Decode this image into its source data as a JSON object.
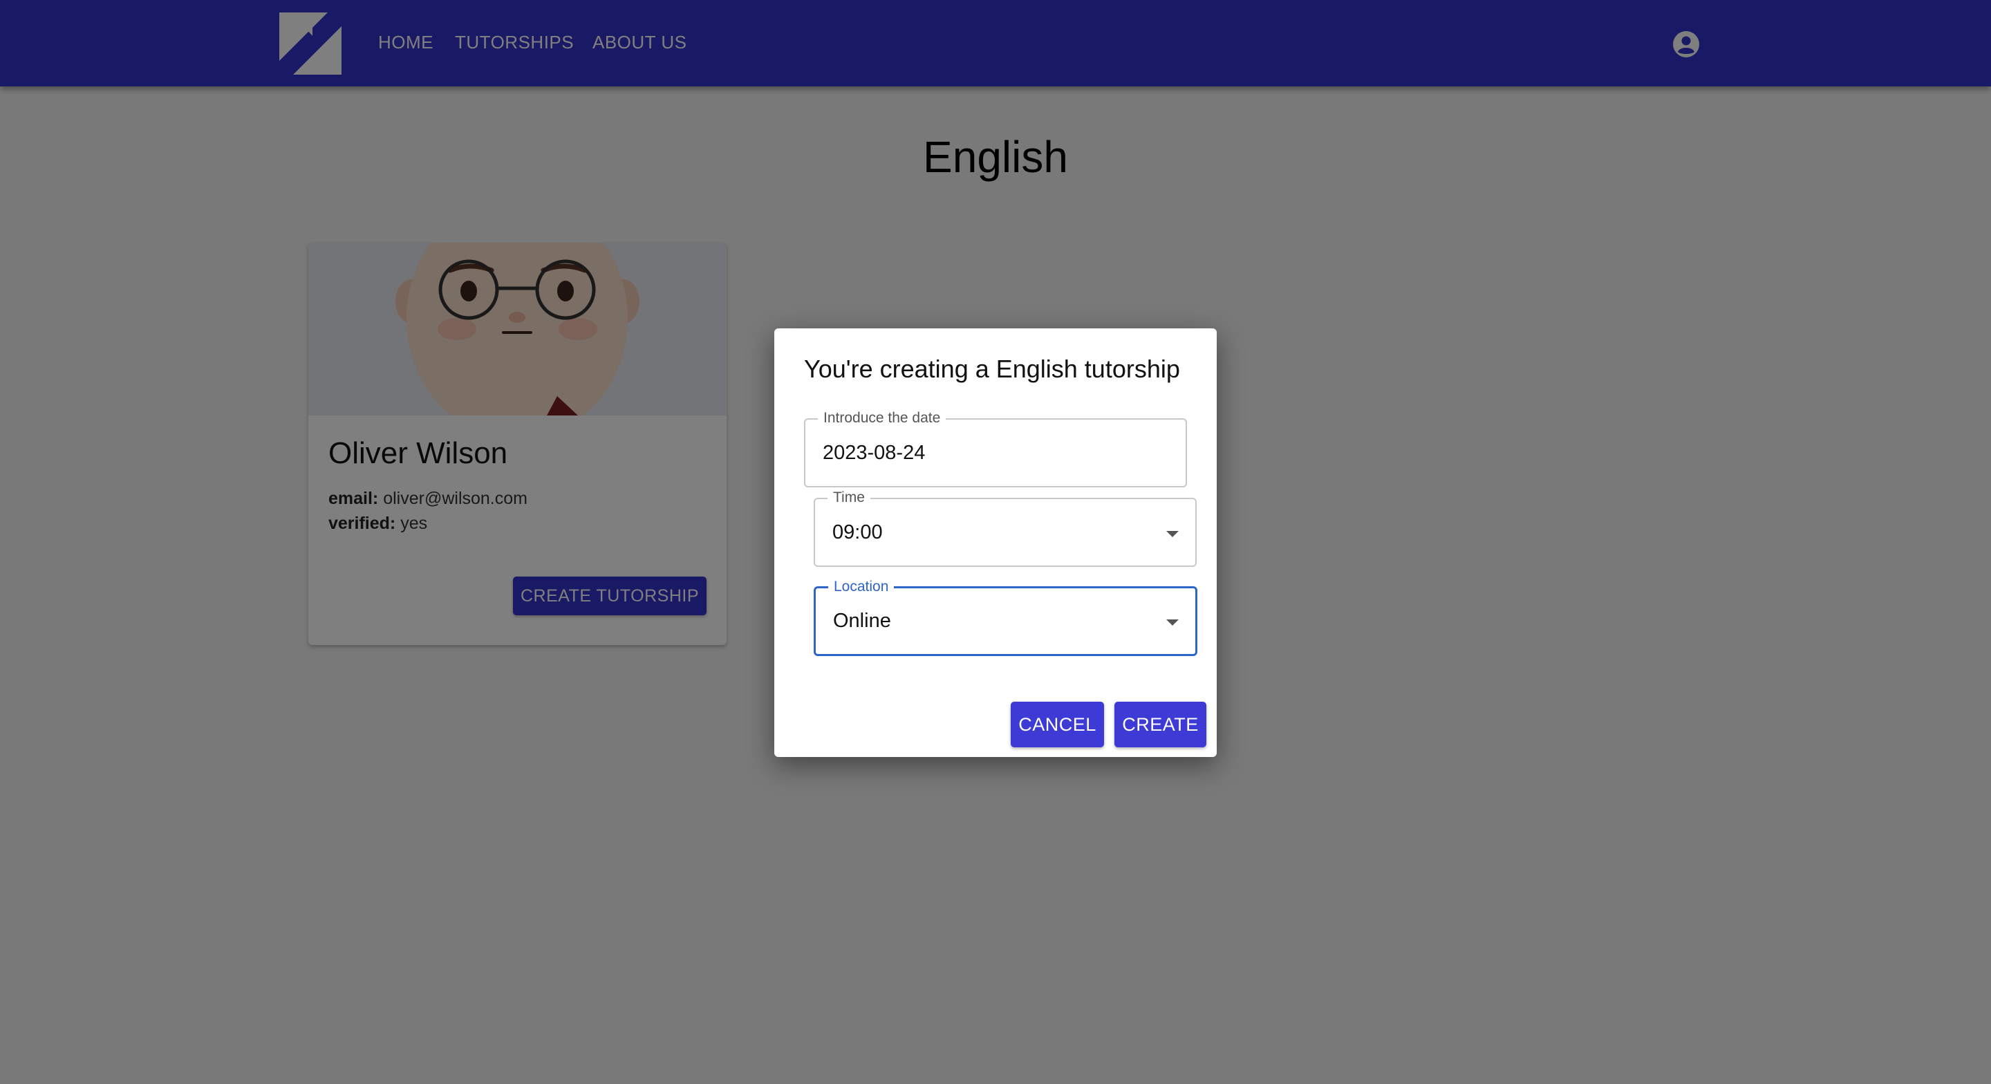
{
  "header": {
    "logo_icon": "brand-logo-icon",
    "nav": [
      {
        "label": "HOME"
      },
      {
        "label": "TUTORSHIPS"
      },
      {
        "label": "ABOUT US"
      }
    ],
    "account_icon": "account-circle-icon"
  },
  "page": {
    "title": "English"
  },
  "tutor_card": {
    "name": "Oliver Wilson",
    "email_label": "email:",
    "email": "oliver@wilson.com",
    "verified_label": "verified:",
    "verified": "yes",
    "button_label": "CREATE TUTORSHIP"
  },
  "dialog": {
    "title": "You're creating a English tutorship",
    "date_field": {
      "label": "Introduce the date",
      "value": "2023-08-24"
    },
    "time_field": {
      "label": "Time",
      "value": "09:00"
    },
    "location_field": {
      "label": "Location",
      "value": "Online"
    },
    "cancel_label": "CANCEL",
    "create_label": "CREATE"
  },
  "colors": {
    "primary": "#3533cd",
    "focus": "#2f64c8"
  }
}
